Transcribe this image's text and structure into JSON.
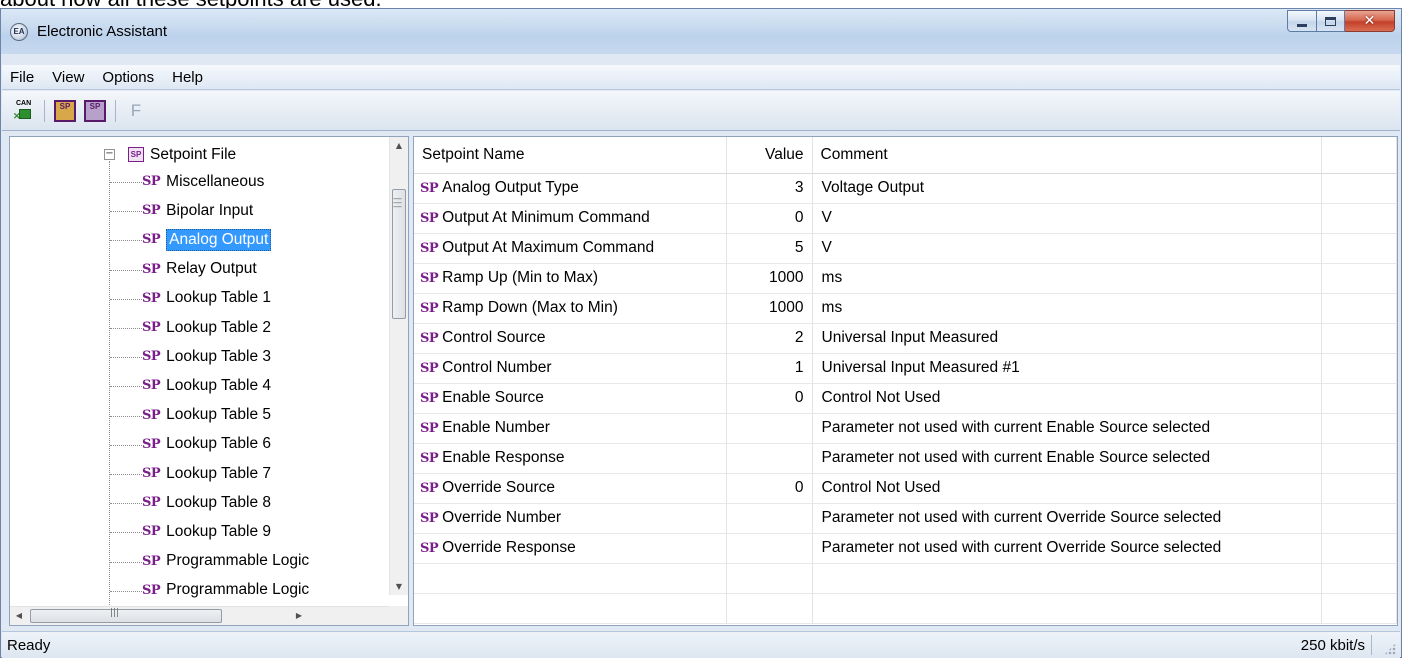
{
  "window": {
    "caption_overflow": "about how all these setpoints are used.",
    "title": "Electronic Assistant",
    "icon_text": "EA"
  },
  "menu": {
    "items": [
      "File",
      "View",
      "Options",
      "Help"
    ]
  },
  "toolbar": {
    "buttons": [
      {
        "name": "can-connect-icon",
        "label": "CAN"
      },
      {
        "name": "open-setpoint-file-icon",
        "label": "SP"
      },
      {
        "name": "save-setpoint-file-icon",
        "label": "SP"
      },
      {
        "name": "flash-icon",
        "label": "F"
      }
    ]
  },
  "tree": {
    "root": "Setpoint File",
    "root_badge": "SP",
    "items": [
      "Miscellaneous",
      "Bipolar Input",
      "Analog Output",
      "Relay Output",
      "Lookup Table 1",
      "Lookup Table 2",
      "Lookup Table 3",
      "Lookup Table 4",
      "Lookup Table 5",
      "Lookup Table 6",
      "Lookup Table 7",
      "Lookup Table 8",
      "Lookup Table 9",
      "Programmable Logic",
      "Programmable Logic"
    ],
    "selected_index": 2,
    "item_badge": "SP"
  },
  "grid": {
    "columns": [
      "Setpoint Name",
      "Value",
      "Comment"
    ],
    "badge": "SP",
    "rows": [
      {
        "name": "Analog Output Type",
        "value": "3",
        "comment": "Voltage Output"
      },
      {
        "name": "Output At Minimum Command",
        "value": "0",
        "comment": "V"
      },
      {
        "name": "Output At Maximum Command",
        "value": "5",
        "comment": "V"
      },
      {
        "name": "Ramp Up (Min to Max)",
        "value": "1000",
        "comment": "ms"
      },
      {
        "name": "Ramp Down (Max to Min)",
        "value": "1000",
        "comment": "ms"
      },
      {
        "name": "Control Source",
        "value": "2",
        "comment": "Universal Input Measured"
      },
      {
        "name": "Control Number",
        "value": "1",
        "comment": "Universal Input Measured #1"
      },
      {
        "name": "Enable Source",
        "value": "0",
        "comment": "Control Not Used"
      },
      {
        "name": "Enable Number",
        "value": "",
        "comment": "Parameter not used with current Enable Source selected"
      },
      {
        "name": "Enable Response",
        "value": "",
        "comment": "Parameter not used with current Enable Source selected"
      },
      {
        "name": "Override Source",
        "value": "0",
        "comment": "Control Not Used"
      },
      {
        "name": "Override Number",
        "value": "",
        "comment": "Parameter not used with current Override Source selected"
      },
      {
        "name": "Override Response",
        "value": "",
        "comment": "Parameter not used with current Override Source selected"
      }
    ]
  },
  "status": {
    "left": "Ready",
    "right": "250 kbit/s"
  }
}
